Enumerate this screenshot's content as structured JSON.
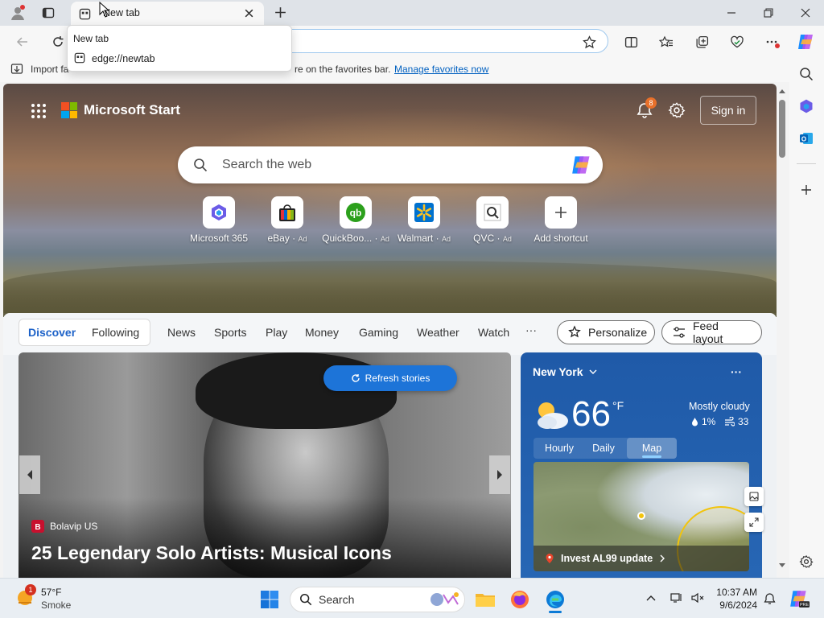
{
  "browser": {
    "tab_title": "New tab",
    "tooltip_title": "New tab",
    "tooltip_url": "edge://newtab",
    "favorites_bar": {
      "import_text": "Import fa",
      "middle_text": "re on the favorites bar.",
      "manage_link": "Manage favorites now"
    }
  },
  "newtab": {
    "brand": "Microsoft Start",
    "notifications_count": "8",
    "signin_label": "Sign in",
    "search_placeholder": "Search the web",
    "shortcuts": [
      {
        "label": "Microsoft 365",
        "ad": ""
      },
      {
        "label": "eBay",
        "ad": "Ad"
      },
      {
        "label": "QuickBoo...",
        "ad": "Ad"
      },
      {
        "label": "Walmart",
        "ad": "Ad"
      },
      {
        "label": "QVC",
        "ad": "Ad"
      },
      {
        "label": "Add shortcut",
        "ad": ""
      }
    ],
    "nav": {
      "discover": "Discover",
      "following": "Following",
      "items": [
        "News",
        "Sports",
        "Play",
        "Money",
        "Gaming",
        "Weather",
        "Watch"
      ],
      "more": "···",
      "personalize": "Personalize",
      "feed_layout": "Feed layout"
    },
    "feed": {
      "refresh": "Refresh stories",
      "source": "Bolavip US",
      "headline": "25 Legendary Solo Artists: Musical Icons"
    },
    "weather": {
      "location": "New York",
      "temp": "66",
      "unit": "°F",
      "condition": "Mostly cloudy",
      "precip": "1%",
      "wind": "33",
      "tabs": [
        "Hourly",
        "Daily",
        "Map"
      ],
      "alert": "Invest AL99 update"
    }
  },
  "taskbar": {
    "temp": "57°F",
    "condition": "Smoke",
    "weather_badge": "1",
    "search_label": "Search",
    "time": "10:37 AM",
    "date": "9/6/2024"
  },
  "colors": {
    "accent": "#1d74d8",
    "weather_bg": "#2766b4",
    "badge": "#e8702a"
  }
}
